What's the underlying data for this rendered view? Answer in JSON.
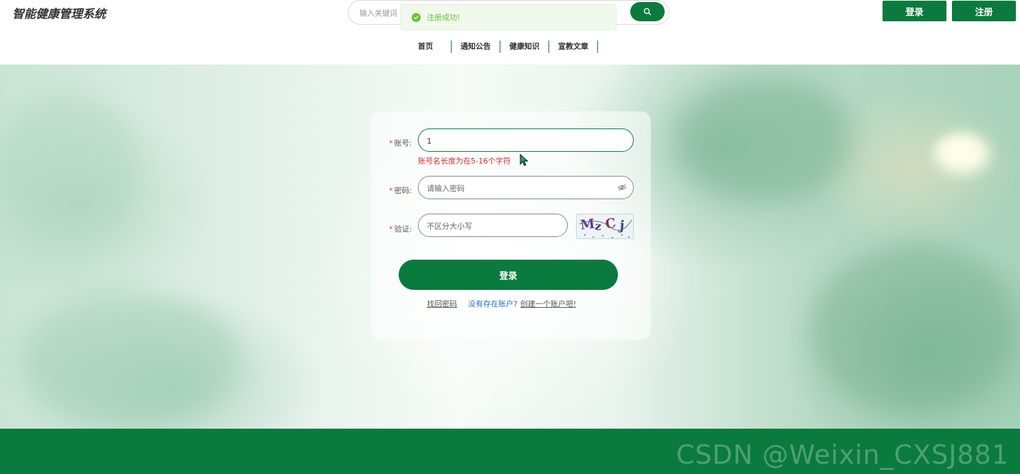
{
  "header": {
    "title": "智能健康管理系统",
    "search_placeholder": "输入关键词",
    "login_label": "登录",
    "register_label": "注册"
  },
  "toast": {
    "message": "注册成功!",
    "type": "success"
  },
  "nav": {
    "items": [
      {
        "label": "首页"
      },
      {
        "label": "通知公告"
      },
      {
        "label": "健康知识"
      },
      {
        "label": "宣教文章"
      }
    ]
  },
  "form": {
    "account": {
      "label": "账号:",
      "value": "1",
      "error": "账号名长度为在5-16个字符"
    },
    "password": {
      "label": "密码:",
      "placeholder": "请输入密码"
    },
    "captcha": {
      "label": "验证:",
      "placeholder": "不区分大小写",
      "image_text": "Mz Cj"
    },
    "submit_label": "登录",
    "forgot_label": "找回密码",
    "no_account_label": "没有存在账户?",
    "create_label": "创建一个账户吧!"
  },
  "watermark": "CSDN @Weixin_CXSJ881",
  "colors": {
    "primary": "#0b7a3e",
    "error": "#d32f2f",
    "success": "#67c23a",
    "link": "#2a6bd1"
  }
}
